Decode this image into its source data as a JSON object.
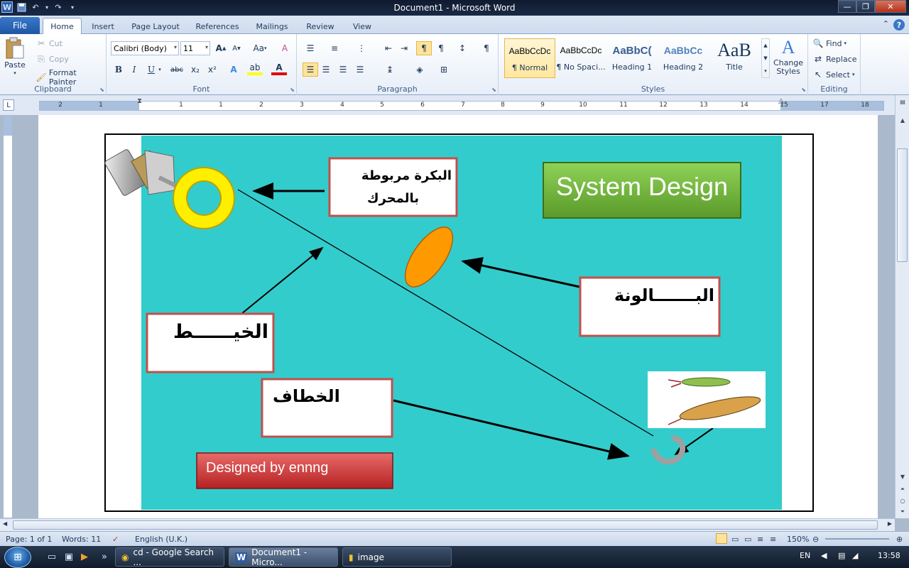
{
  "window": {
    "title": "Document1  -  Microsoft Word"
  },
  "qat": {
    "logo": "W",
    "save": "💾",
    "undo": "↶",
    "redo": "↷",
    "more": "▾"
  },
  "tabs": {
    "file": "File",
    "items": [
      "Home",
      "Insert",
      "Page Layout",
      "References",
      "Mailings",
      "Review",
      "View"
    ]
  },
  "clipboard": {
    "paste": "Paste",
    "cut": "Cut",
    "copy": "Copy",
    "format_painter": "Format Painter",
    "label": "Clipboard"
  },
  "font": {
    "family": "Calibri (Body)",
    "size": "11",
    "label": "Font",
    "bold": "B",
    "italic": "I",
    "underline": "U",
    "strike": "abc",
    "sub": "x₂",
    "sup": "x²",
    "grow": "A",
    "shrink": "A",
    "case": "Aa",
    "clear": "A",
    "effects": "A",
    "highlight": "ab",
    "color": "A"
  },
  "paragraph": {
    "label": "Paragraph",
    "pilcrow": "¶"
  },
  "styles": {
    "label": "Styles",
    "items": [
      {
        "sample": "AaBbCcDc",
        "name": "¶ Normal"
      },
      {
        "sample": "AaBbCcDc",
        "name": "¶ No Spaci..."
      },
      {
        "sample": "AaBbC(",
        "name": "Heading 1"
      },
      {
        "sample": "AaBbCc",
        "name": "Heading 2"
      },
      {
        "sample": "AaB",
        "name": "Title"
      }
    ],
    "change_styles": "Change Styles"
  },
  "editing": {
    "label": "Editing",
    "find": "Find",
    "replace": "Replace",
    "select": "Select"
  },
  "ruler": {
    "marks": [
      "2",
      "1",
      "1",
      "1",
      "2",
      "3",
      "4",
      "5",
      "6",
      "7",
      "8",
      "9",
      "10",
      "11",
      "12",
      "13",
      "14",
      "15",
      "16",
      "17",
      "18"
    ]
  },
  "diagram": {
    "title_button": "System Design",
    "label_pulley_line1": "البكرة مربوطة",
    "label_pulley_line2": "بالمحرك",
    "label_balloon": "البـــــــالونة",
    "label_thread": "الخيــــــط",
    "label_hook": "الخطاف",
    "designed_by": "Designed by ennng"
  },
  "status": {
    "page": "Page: 1 of 1",
    "words": "Words: 11",
    "language": "English (U.K.)",
    "zoom": "150%"
  },
  "taskbar": {
    "buttons": [
      "cd - Google Search ...",
      "Document1 - Micro...",
      "image"
    ],
    "lang": "EN",
    "clock": "13:58"
  },
  "colors": {
    "canvas": "#33cccc",
    "title_button": "#7ac143",
    "designed_button": "#d63a3a",
    "label_border": "#c0504d",
    "balloon": "#ff9900",
    "pulley": "#ffee00"
  }
}
